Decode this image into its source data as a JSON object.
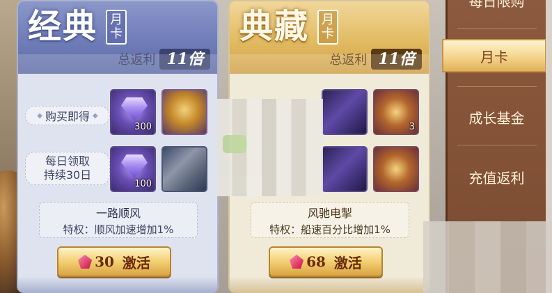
{
  "cards": [
    {
      "id": "classic",
      "title": "经典",
      "tag_top": "月",
      "tag_bottom": "卡",
      "rebate_label": "总返利",
      "rebate_mult": "11倍",
      "row1_label": "购买即得",
      "row2_line1": "每日领取",
      "row2_line2": "持续30日",
      "row1_items": [
        {
          "icon": "purple-diamond-icon",
          "qty": "300"
        },
        {
          "icon": "treasure-chest-icon",
          "qty": ""
        }
      ],
      "row2_items": [
        {
          "icon": "purple-diamond-icon",
          "qty": "100"
        },
        {
          "icon": "blurred-item-icon",
          "qty": ""
        }
      ],
      "perk_name": "一路顺风",
      "perk_desc": "特权：顺风加速增加1%",
      "button_cost": "30",
      "button_label": "激活"
    },
    {
      "id": "collect",
      "title": "典藏",
      "tag_top": "月",
      "tag_bottom": "卡",
      "rebate_label": "总返利",
      "rebate_mult": "11倍",
      "row1_items": [
        {
          "icon": "blurred-item-icon",
          "qty": ""
        },
        {
          "icon": "envelope-reward-icon",
          "qty": "3"
        }
      ],
      "row2_items": [
        {
          "icon": "blurred-item-icon",
          "qty": ""
        },
        {
          "icon": "jeweled-chest-icon",
          "qty": ""
        }
      ],
      "perk_name": "风驰电掣",
      "perk_desc": "特权：船速百分比增加1%",
      "button_cost": "68",
      "button_label": "激活"
    }
  ],
  "sidenav": {
    "items": [
      "每日限购",
      "月卡",
      "成长基金",
      "充值返利"
    ],
    "active_index": 1
  },
  "colors": {
    "classic_header": "#6f7db8",
    "collect_header": "#e2bb63",
    "nav_bg": "#7a4a30",
    "button_gold": "#f2cf72"
  }
}
